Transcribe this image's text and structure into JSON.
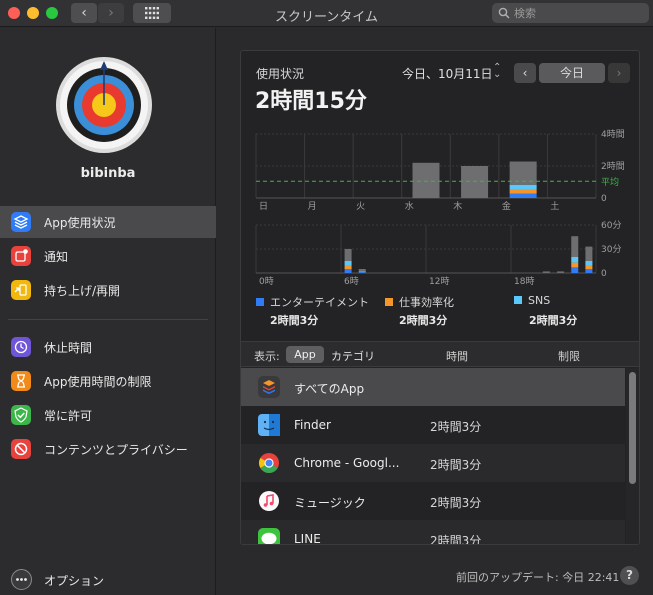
{
  "window": {
    "title": "スクリーンタイム"
  },
  "toolbar": {
    "back": "‹",
    "forward": "›",
    "search_placeholder": "検索"
  },
  "sidebar": {
    "username": "bibinba",
    "items": [
      {
        "label": "App使用状況",
        "icon": "layers-icon",
        "color": "#2f7cf6",
        "active": true
      },
      {
        "label": "通知",
        "icon": "notification-icon",
        "color": "#e8423d"
      },
      {
        "label": "持ち上げ/再開",
        "icon": "pickup-icon",
        "color": "#f2b80f"
      },
      {
        "label": "休止時間",
        "icon": "downtime-icon",
        "color": "#6f56d8"
      },
      {
        "label": "App使用時間の制限",
        "icon": "hourglass-icon",
        "color": "#f28a1a"
      },
      {
        "label": "常に許可",
        "icon": "checkmark-shield-icon",
        "color": "#3cb64a"
      },
      {
        "label": "コンテンツとプライバシー",
        "icon": "restriction-icon",
        "color": "#e8423d"
      }
    ],
    "options_label": "オプション"
  },
  "usage": {
    "label": "使用状況",
    "total": "2時間15分",
    "date": "今日、10月11日",
    "today_button": "今日",
    "prev": "‹",
    "next": "›"
  },
  "colors": {
    "entertainment": "#2f7cf6",
    "productivity": "#f5952a",
    "sns": "#5ac8fa",
    "other": "#6e6e70",
    "average": "#3cb64a"
  },
  "chart_data": [
    {
      "type": "bar",
      "categories": [
        "日",
        "月",
        "火",
        "水",
        "木",
        "金",
        "土"
      ],
      "series": [
        {
          "name": "エンターテイメント",
          "values": [
            0,
            0,
            0,
            0,
            0,
            0.28,
            0
          ]
        },
        {
          "name": "仕事効率化",
          "values": [
            0,
            0,
            0,
            0,
            0,
            0.25,
            0
          ]
        },
        {
          "name": "SNS",
          "values": [
            0,
            0,
            0,
            0,
            0,
            0.3,
            0
          ]
        },
        {
          "name": "",
          "values": [
            0,
            0,
            0,
            2.2,
            2.0,
            1.45,
            0
          ]
        }
      ],
      "yticks": [
        "4時間",
        "2時間",
        "0"
      ],
      "ylim": [
        0,
        4
      ],
      "average": 1.05,
      "average_label": "平均",
      "grid": true
    },
    {
      "type": "bar",
      "categories": [
        "0時",
        "6時",
        "12時",
        "18時"
      ],
      "x": [
        0,
        1,
        2,
        3,
        4,
        5,
        6,
        7,
        8,
        9,
        10,
        11,
        12,
        13,
        14,
        15,
        16,
        17,
        18,
        19,
        20,
        21,
        22,
        23
      ],
      "series": [
        {
          "name": "エンターテイメント",
          "values": [
            0,
            0,
            0,
            0,
            0,
            0,
            5,
            1,
            0,
            0,
            0,
            0,
            0,
            0,
            0,
            0,
            0,
            0,
            0,
            0,
            0,
            0,
            7,
            5
          ]
        },
        {
          "name": "仕事効率化",
          "values": [
            0,
            0,
            0,
            0,
            0,
            0,
            5,
            0,
            0,
            0,
            0,
            0,
            0,
            0,
            0,
            0,
            0,
            0,
            0,
            0,
            0,
            0,
            6,
            5
          ]
        },
        {
          "name": "SNS",
          "values": [
            0,
            0,
            0,
            0,
            0,
            0,
            5,
            1,
            0,
            0,
            0,
            0,
            0,
            0,
            0,
            0,
            0,
            0,
            0,
            0,
            0,
            0,
            7,
            5
          ]
        },
        {
          "name": "",
          "values": [
            0,
            0,
            0,
            0,
            0,
            0,
            15,
            3,
            0,
            0,
            0,
            0,
            0,
            0,
            0,
            0,
            0,
            0,
            0,
            0,
            2,
            2,
            26,
            18
          ]
        }
      ],
      "yticks": [
        "60分",
        "30分",
        "0"
      ],
      "ylim": [
        0,
        60
      ],
      "grid": true
    }
  ],
  "legend": [
    {
      "name": "エンターテイメント",
      "value": "2時間3分",
      "color": "#2f7cf6"
    },
    {
      "name": "仕事効率化",
      "value": "2時間3分",
      "color": "#f5952a"
    },
    {
      "name": "SNS",
      "value": "2時間3分",
      "color": "#5ac8fa"
    }
  ],
  "table": {
    "show_label": "表示:",
    "tab_app": "App",
    "tab_category": "カテゴリ",
    "col_time": "時間",
    "col_limit": "制限",
    "rows": [
      {
        "name": "すべてのApp",
        "time": "",
        "icon": "all-apps-icon"
      },
      {
        "name": "Finder",
        "time": "2時間3分",
        "icon": "finder-icon"
      },
      {
        "name": "Chrome - Googl...",
        "time": "2時間3分",
        "icon": "chrome-icon"
      },
      {
        "name": "ミュージック",
        "time": "2時間3分",
        "icon": "music-icon"
      },
      {
        "name": "LINE",
        "time": "2時間3分",
        "icon": "line-icon"
      }
    ]
  },
  "footer": {
    "last_update": "前回のアップデート: 今日 22:41",
    "help": "?"
  }
}
